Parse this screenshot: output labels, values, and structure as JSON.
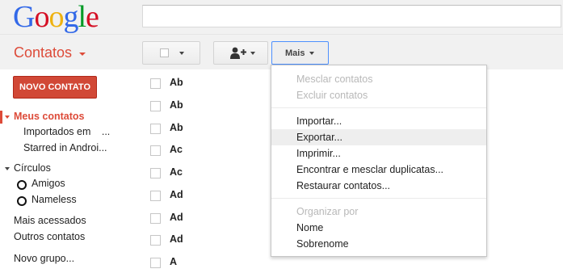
{
  "header": {
    "logo_letters": [
      {
        "char": "G",
        "color": "#3369e8"
      },
      {
        "char": "o",
        "color": "#d50f25"
      },
      {
        "char": "o",
        "color": "#eeb211"
      },
      {
        "char": "g",
        "color": "#3369e8"
      },
      {
        "char": "l",
        "color": "#009925"
      },
      {
        "char": "e",
        "color": "#d50f25"
      }
    ],
    "search_value": ""
  },
  "appbar": {
    "title": "Contatos",
    "more_label": "Mais"
  },
  "sidebar": {
    "new_contact_label": "NOVO CONTATO",
    "my_contacts": "Meus contatos",
    "imported": "Importados em",
    "imported_suffix": "...",
    "starred": "Starred in Androi...",
    "circles": "Círculos",
    "circle_items": [
      "Amigos",
      "Nameless"
    ],
    "most_contacted": "Mais acessados",
    "other_contacts": "Outros contatos",
    "new_group": "Novo grupo..."
  },
  "contacts": [
    "Ab",
    "Ab",
    "Ab",
    "Ac",
    "Ac",
    "Ad",
    "Ad",
    "Ad",
    "A"
  ],
  "menu": {
    "merge": "Mesclar contatos",
    "delete": "Excluir contatos",
    "import": "Importar...",
    "export": "Exportar...",
    "print": "Imprimir...",
    "find_duplicates": "Encontrar e mesclar duplicatas...",
    "restore": "Restaurar contatos...",
    "sort_by": "Organizar por",
    "sort_name": "Nome",
    "sort_surname": "Sobrenome"
  },
  "colors": {
    "accent_red": "#dd4b39",
    "button_red": "#d14836",
    "focus_blue": "#4d90fe"
  }
}
